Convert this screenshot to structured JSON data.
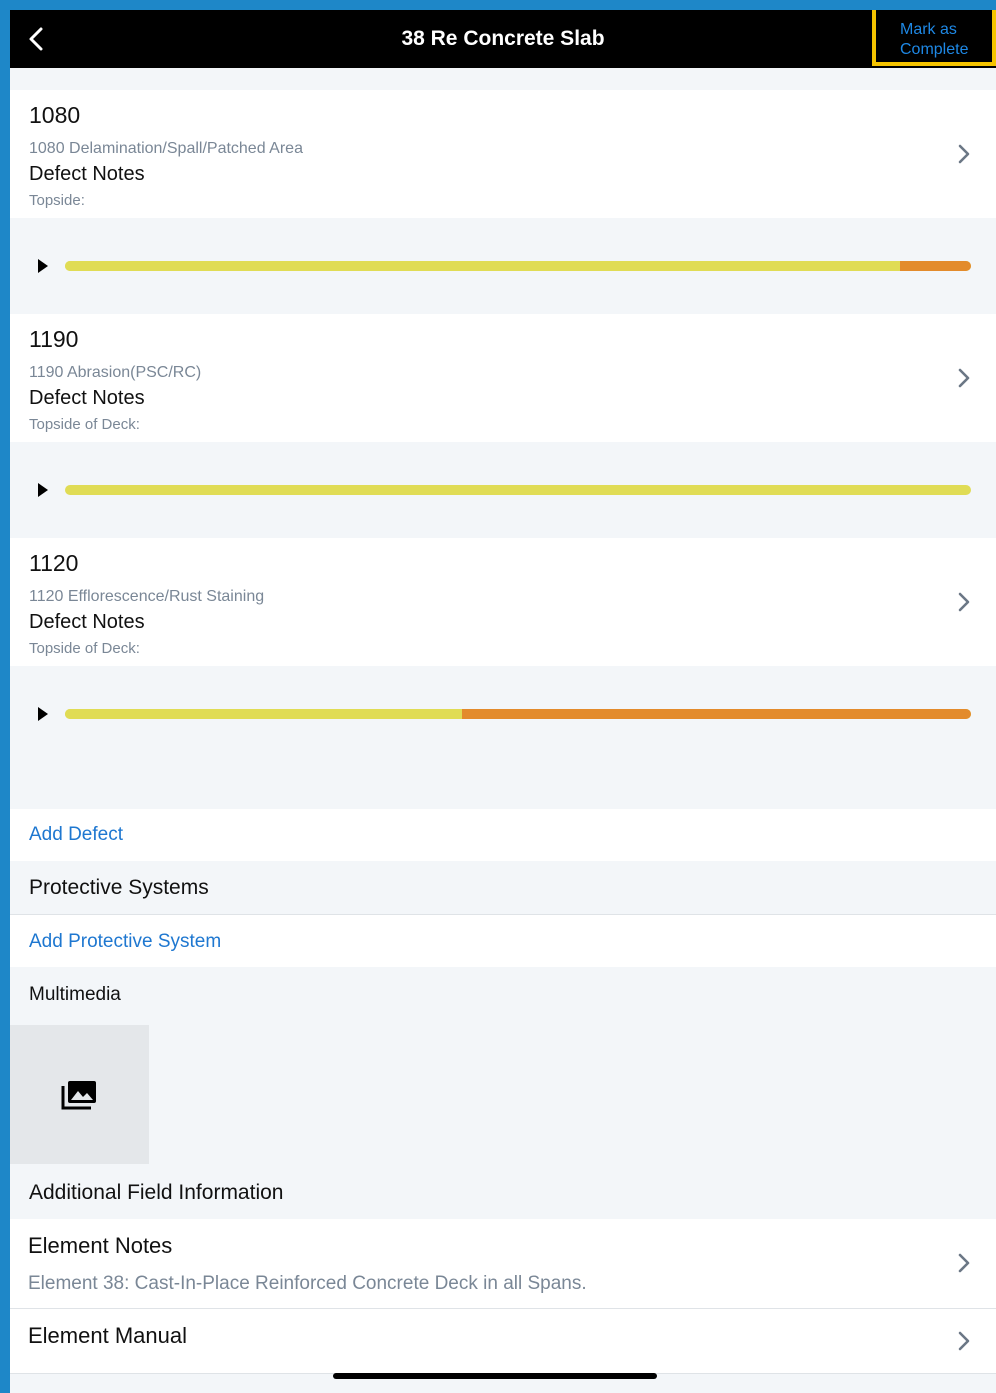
{
  "header": {
    "title": "38 Re Concrete Slab",
    "mark_complete_label": "Mark as Complete",
    "mark_complete_line1": "Mark as",
    "mark_complete_line2": "Complete"
  },
  "defects": [
    {
      "code": "1080",
      "name": "1080 Delamination/Spall/Patched Area",
      "notes_label": "Defect Notes",
      "location": "Topside:",
      "condition_states": [
        0.922,
        0.078
      ]
    },
    {
      "code": "1190",
      "name": "1190 Abrasion(PSC/RC)",
      "notes_label": "Defect Notes",
      "location": "Topside of Deck:",
      "condition_states": [
        1.0,
        0.0
      ]
    },
    {
      "code": "1120",
      "name": "1120 Efflorescence/Rust Staining",
      "notes_label": "Defect Notes",
      "location": "Topside of Deck:",
      "condition_states": [
        0.438,
        0.562
      ]
    }
  ],
  "condition_colors": {
    "cs2": "#e0dc55",
    "cs3": "#e38b2c"
  },
  "add_defect_label": "Add Defect",
  "protective_systems": {
    "title": "Protective Systems",
    "add_label": "Add Protective System"
  },
  "multimedia": {
    "title": "Multimedia",
    "icon": "photo-library-icon"
  },
  "additional_info": {
    "title": "Additional Field Information",
    "element_notes_label": "Element Notes",
    "element_notes_value": "Element 38: Cast-In-Place Reinforced Concrete Deck in all Spans.",
    "element_manual_label": "Element Manual"
  },
  "colors": {
    "header_bg": "#000000",
    "accent_link": "#1e77d0",
    "highlight_border": "#f5c400",
    "frame": "#1e87c8"
  }
}
